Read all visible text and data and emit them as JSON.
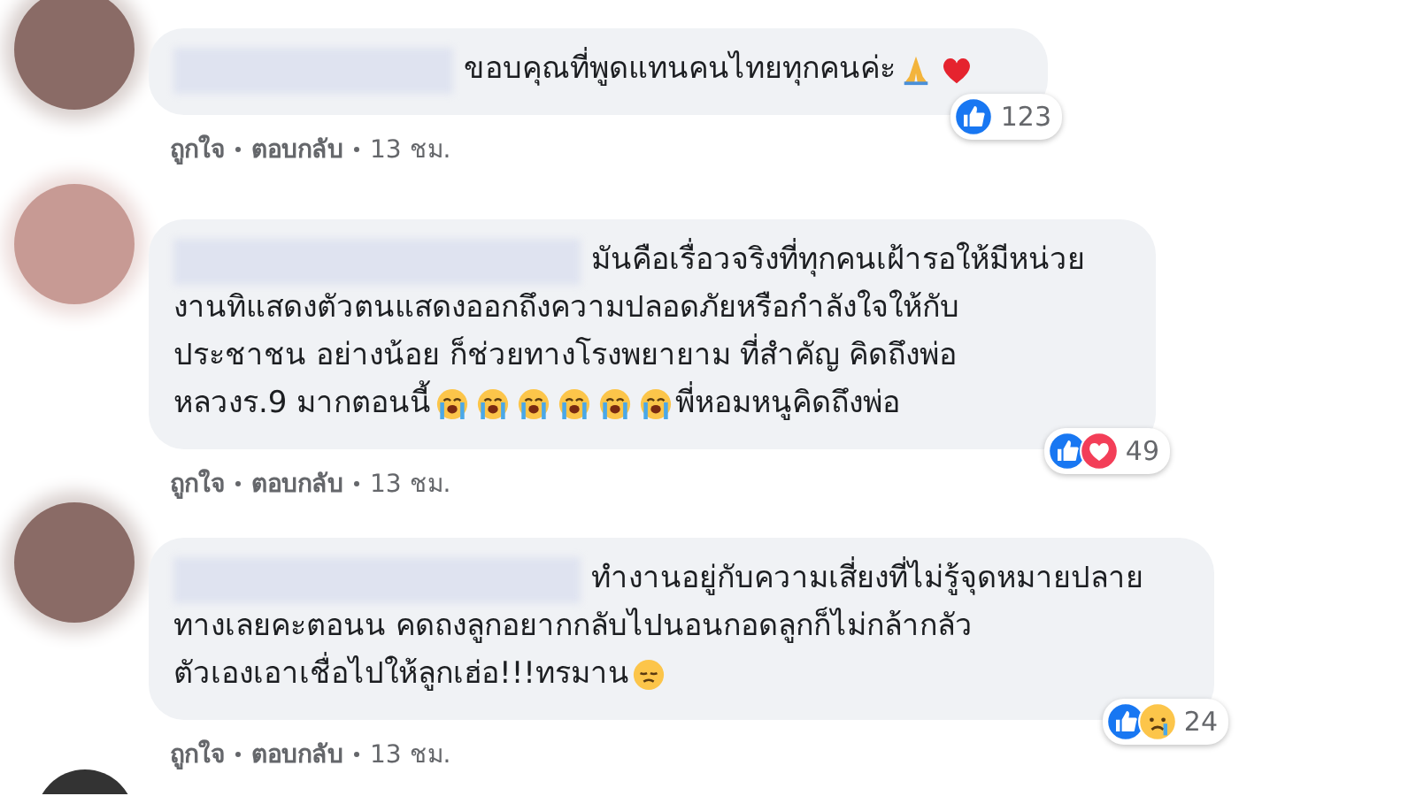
{
  "comments": [
    {
      "lines": [
        [
          {
            "kind": "text",
            "text": "ขอบคุณที่พูดแทนคนไทยทุกคนค่ะ "
          },
          {
            "kind": "pray"
          },
          {
            "kind": "heart"
          }
        ]
      ],
      "actions": [
        "ถูกใจ",
        "ตอบกลับ"
      ],
      "time": "13 ชม.",
      "reactions": [
        {
          "kind": "like"
        }
      ],
      "reaction_count": "123"
    },
    {
      "lines": [
        [
          {
            "kind": "text",
            "text": "มันคือเรื่อวจริงที่ทุกคนเฝ้ารอให้มีหน่วย"
          }
        ],
        [
          {
            "kind": "text",
            "text": "งานทิแสดงตัวตนแสดงออกถึงความปลอดภัยหรือกำลังใจให้กับ"
          }
        ],
        [
          {
            "kind": "text",
            "text": "ประชาชน อย่างน้อย ก็ช่วยทางโรงพยายาม ที่สำคัญ คิดถึงพ่อ"
          }
        ],
        [
          {
            "kind": "text",
            "text": "หลวงร.9 มากตอนนี้"
          },
          {
            "kind": "sob"
          },
          {
            "kind": "sob"
          },
          {
            "kind": "sob"
          },
          {
            "kind": "sob"
          },
          {
            "kind": "sob"
          },
          {
            "kind": "sob"
          },
          {
            "kind": "text",
            "text": "พี่หอมหนูคิดถึงพ่อ"
          }
        ]
      ],
      "actions": [
        "ถูกใจ",
        "ตอบกลับ"
      ],
      "time": "13 ชม.",
      "reactions": [
        {
          "kind": "like"
        },
        {
          "kind": "love"
        }
      ],
      "reaction_count": "49"
    },
    {
      "lines": [
        [
          {
            "kind": "text",
            "text": "ทำงานอยู่กับความเสี่ยงที่ไม่รู้จุดหมายปลาย"
          }
        ],
        [
          {
            "kind": "text",
            "text": "ทางเลยคะตอนน คดถงลูกอยากกลับไปนอนกอดลูกก็ไม่กล้ากลัว"
          }
        ],
        [
          {
            "kind": "text",
            "text": "ตัวเองเอาเชื่อไปให้ลูกเฮ่อ!!!ทรมาน"
          },
          {
            "kind": "sad"
          }
        ]
      ],
      "actions": [
        "ถูกใจ",
        "ตอบกลับ"
      ],
      "time": "13 ชม.",
      "reactions": [
        {
          "kind": "like"
        },
        {
          "kind": "sad"
        }
      ],
      "reaction_count": "24"
    }
  ]
}
